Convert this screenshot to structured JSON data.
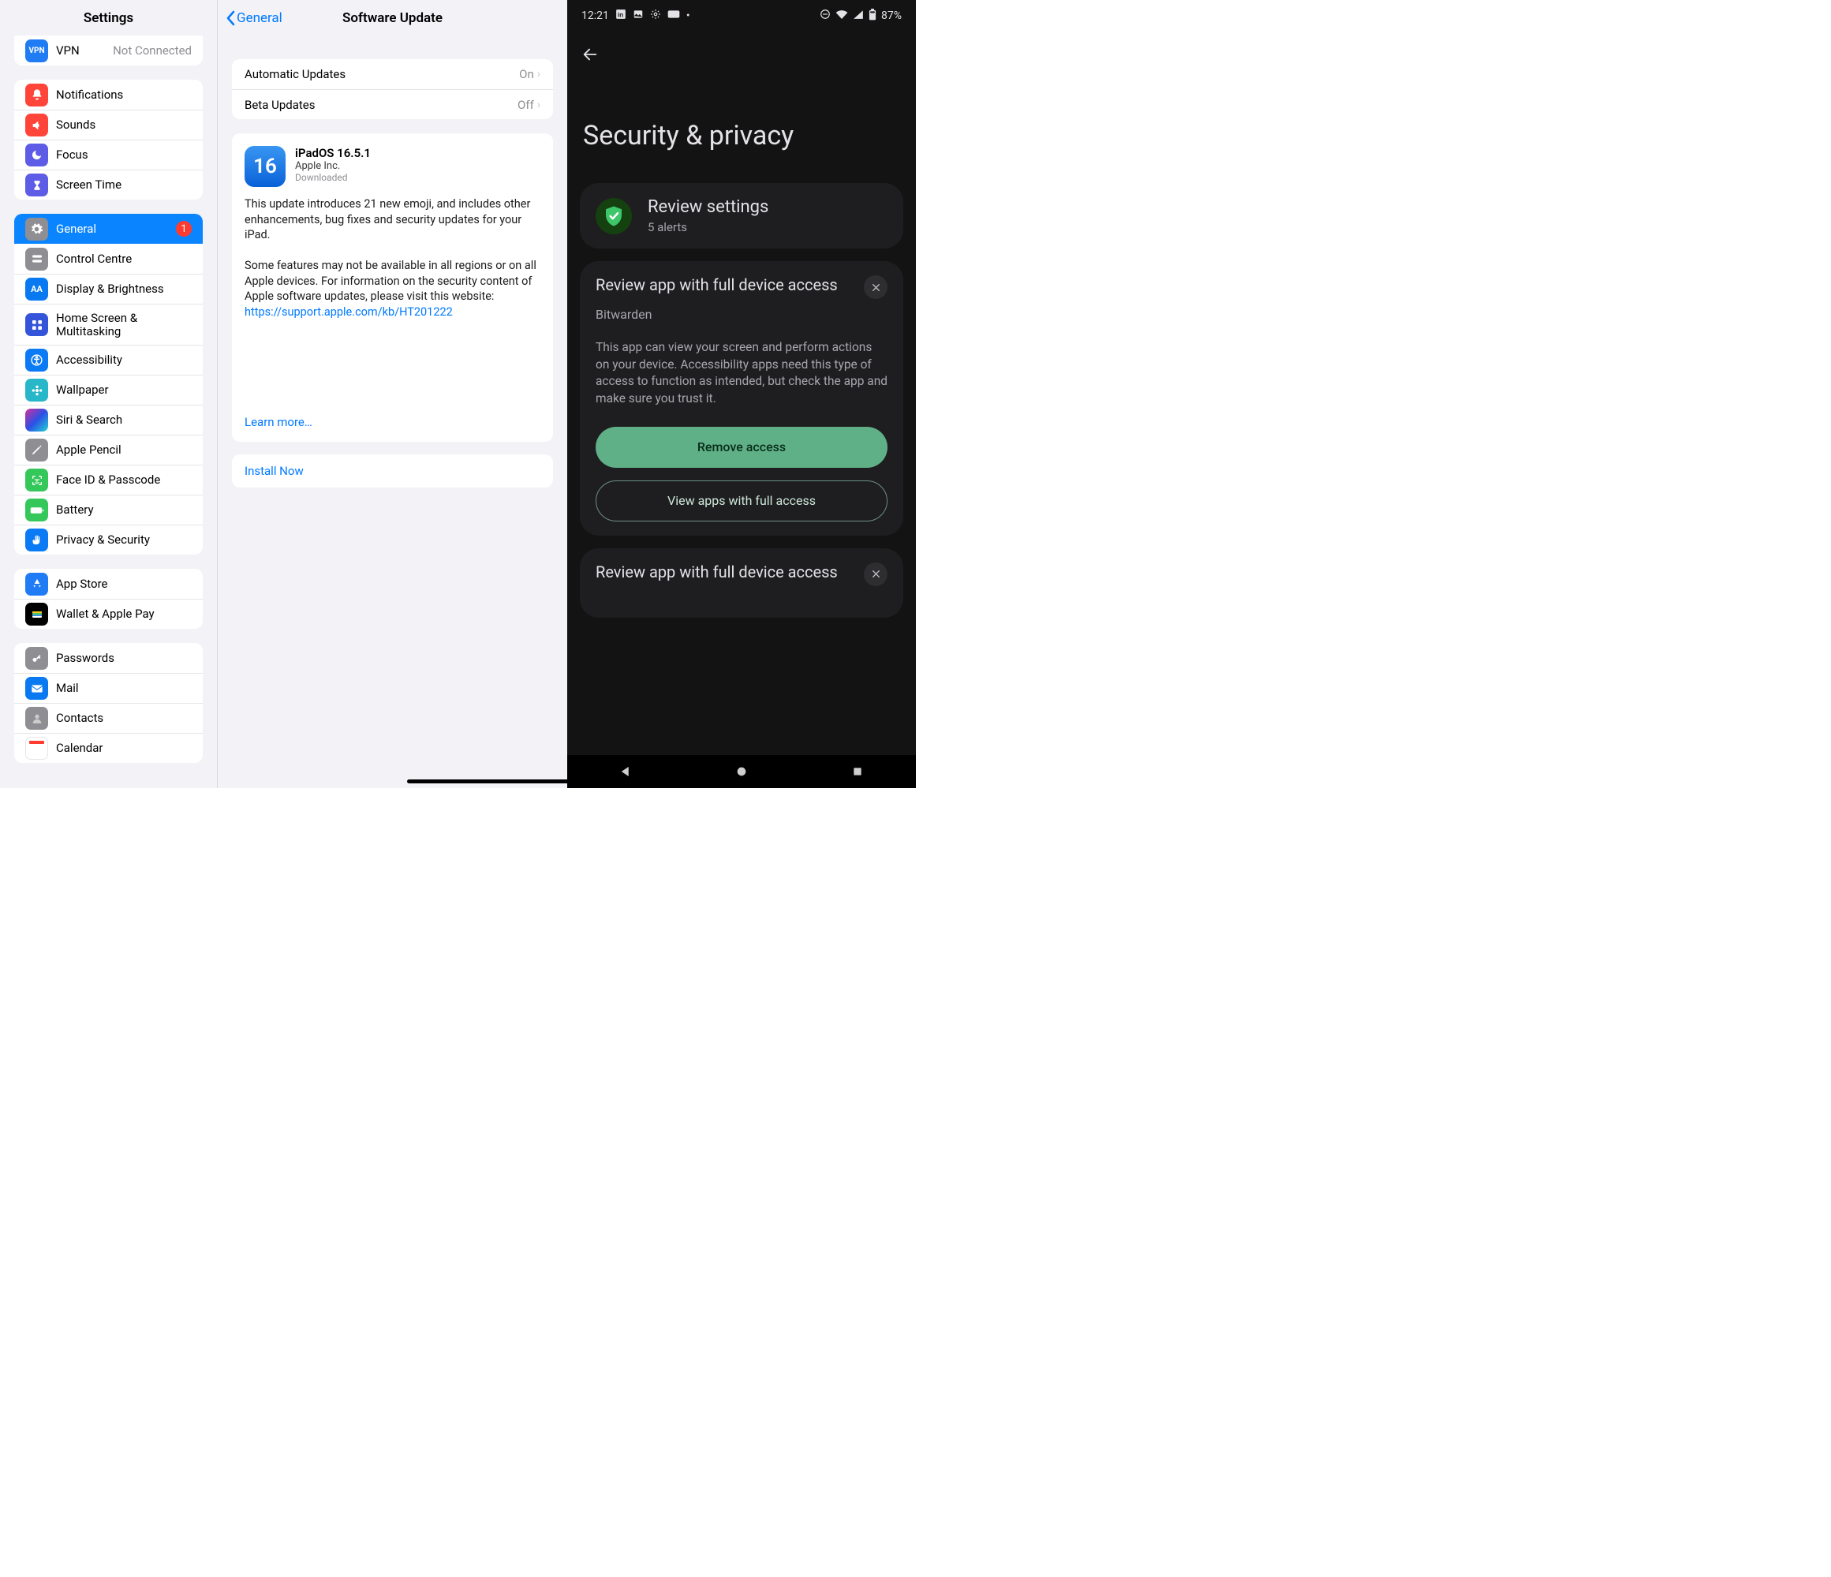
{
  "ipad": {
    "sidebar_title": "Settings",
    "vpn": {
      "label": "VPN",
      "trail": "Not Connected"
    },
    "group_focus": [
      {
        "label": "Notifications"
      },
      {
        "label": "Sounds"
      },
      {
        "label": "Focus"
      },
      {
        "label": "Screen Time"
      }
    ],
    "group_general": [
      {
        "label": "General",
        "badge": "1",
        "selected": true
      },
      {
        "label": "Control Centre"
      },
      {
        "label": "Display & Brightness"
      },
      {
        "label": "Home Screen & Multitasking"
      },
      {
        "label": "Accessibility"
      },
      {
        "label": "Wallpaper"
      },
      {
        "label": "Siri & Search"
      },
      {
        "label": "Apple Pencil"
      },
      {
        "label": "Face ID & Passcode"
      },
      {
        "label": "Battery"
      },
      {
        "label": "Privacy & Security"
      }
    ],
    "group_store": [
      {
        "label": "App Store"
      },
      {
        "label": "Wallet & Apple Pay"
      }
    ],
    "group_accounts": [
      {
        "label": "Passwords"
      },
      {
        "label": "Mail"
      },
      {
        "label": "Contacts"
      },
      {
        "label": "Calendar"
      }
    ]
  },
  "detail": {
    "back_label": "General",
    "title": "Software Update",
    "auto_label": "Automatic Updates",
    "auto_value": "On",
    "beta_label": "Beta Updates",
    "beta_value": "Off",
    "update": {
      "icon_text": "16",
      "title": "iPadOS 16.5.1",
      "vendor": "Apple Inc.",
      "state": "Downloaded",
      "para1": "This update introduces 21 new emoji, and includes other enhancements, bug fixes and security updates for your iPad.",
      "para2": "Some features may not be available in all regions or on all Apple devices. For information on the security content of Apple software updates, please visit this website:",
      "link": "https://support.apple.com/kb/HT201222",
      "learn_more": "Learn more…",
      "install_label": "Install Now"
    }
  },
  "android": {
    "status": {
      "time": "12:21",
      "battery": "87%"
    },
    "page_title": "Security & privacy",
    "review": {
      "title": "Review settings",
      "subtitle": "5 alerts"
    },
    "card1": {
      "title": "Review app with full device access",
      "app": "Bitwarden",
      "body": "This app can view your screen and perform actions on your device. Accessibility apps need this type of access to function as intended, but check the app and make sure you trust it.",
      "primary": "Remove access",
      "secondary": "View apps with full access"
    },
    "card2": {
      "title": "Review app with full device access"
    }
  }
}
